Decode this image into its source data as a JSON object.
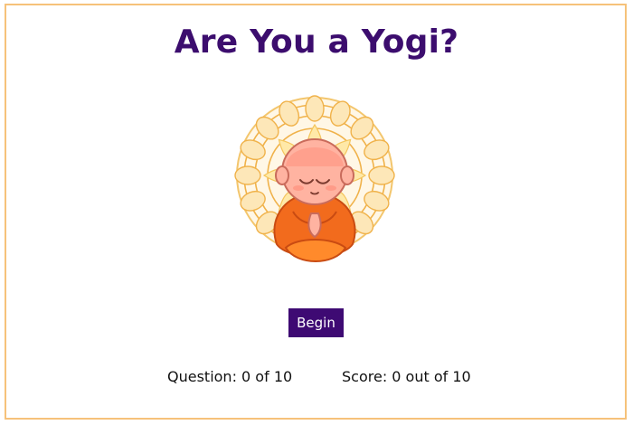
{
  "title": "Are You a Yogi?",
  "begin_label": "Begin",
  "question_text": "Question: 0 of 10",
  "score_text": "Score: 0 out of 10",
  "illustration_icon": "meditating-monk-mandala-icon",
  "colors": {
    "title": "#3c0d6e",
    "button": "#3e0a73",
    "frame_border": "#f6c27a"
  }
}
